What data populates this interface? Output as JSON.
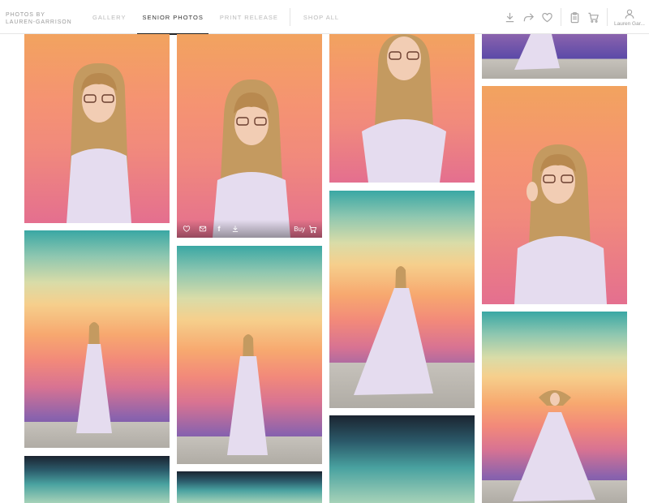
{
  "brand": {
    "line1": "PHOTOS BY",
    "line2": "LAUREN-GARRISON"
  },
  "nav": {
    "tabs": [
      {
        "label": "GALLERY"
      },
      {
        "label": "SENIOR PHOTOS"
      },
      {
        "label": "PRINT RELEASE"
      },
      {
        "label": "SHOP ALL"
      }
    ],
    "active_tab": "SENIOR PHOTOS"
  },
  "toolbar": {
    "icons": [
      "download-icon",
      "share-icon",
      "favorite-icon",
      "clipboard-icon",
      "cart-icon",
      "user-icon"
    ],
    "user_label": "Lauren Gar..."
  },
  "photo_overlay": {
    "icons": [
      "heart-icon",
      "email-icon",
      "facebook-icon",
      "download-icon"
    ],
    "facebook_glyph": "f",
    "buy_label": "Buy"
  },
  "colors": {
    "active_tab": "#333333",
    "inactive_tab": "#b9b9b9",
    "icon": "#a8a8a8",
    "wall_orange": "#f59372",
    "wall_teal": "#3aa7a4",
    "wall_purple": "#5b4aa8",
    "dress_lavender": "#e5dcef",
    "hair": "#c49a60"
  }
}
